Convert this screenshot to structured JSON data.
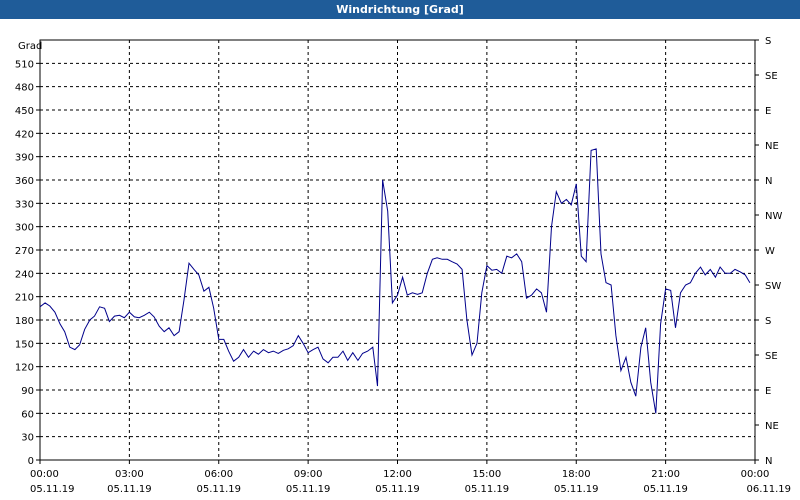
{
  "window": {
    "title": "Windrichtung [Grad]"
  },
  "chart_data": {
    "type": "line",
    "title": "Windrichtung [Grad]",
    "ylabel": "Grad",
    "xlabel": "",
    "ylim": [
      0,
      540
    ],
    "xlim_hours": [
      0,
      24
    ],
    "grid": true,
    "left_ticks": [
      0,
      30,
      60,
      90,
      120,
      150,
      180,
      210,
      240,
      270,
      300,
      330,
      360,
      390,
      420,
      450,
      480,
      510
    ],
    "right_ticks": [
      {
        "value": 0,
        "label": "N"
      },
      {
        "value": 45,
        "label": "NE"
      },
      {
        "value": 90,
        "label": "E"
      },
      {
        "value": 135,
        "label": "SE"
      },
      {
        "value": 180,
        "label": "S"
      },
      {
        "value": 225,
        "label": "SW"
      },
      {
        "value": 270,
        "label": "W"
      },
      {
        "value": 315,
        "label": "NW"
      },
      {
        "value": 360,
        "label": "N"
      },
      {
        "value": 405,
        "label": "NE"
      },
      {
        "value": 450,
        "label": "E"
      },
      {
        "value": 495,
        "label": "SE"
      },
      {
        "value": 540,
        "label": "S"
      }
    ],
    "x_ticks": [
      {
        "hour": 0,
        "time": "00:00",
        "date": "05.11.19"
      },
      {
        "hour": 3,
        "time": "03:00",
        "date": "05.11.19"
      },
      {
        "hour": 6,
        "time": "06:00",
        "date": "05.11.19"
      },
      {
        "hour": 9,
        "time": "09:00",
        "date": "05.11.19"
      },
      {
        "hour": 12,
        "time": "12:00",
        "date": "05.11.19"
      },
      {
        "hour": 15,
        "time": "15:00",
        "date": "05.11.19"
      },
      {
        "hour": 18,
        "time": "18:00",
        "date": "05.11.19"
      },
      {
        "hour": 21,
        "time": "21:00",
        "date": "05.11.19"
      },
      {
        "hour": 24,
        "time": "00:00",
        "date": "06.11.19"
      }
    ],
    "series": [
      {
        "color": "#00008b",
        "x_hours": [
          0,
          0.17,
          0.33,
          0.5,
          0.67,
          0.83,
          1.0,
          1.17,
          1.33,
          1.5,
          1.67,
          1.83,
          2.0,
          2.17,
          2.33,
          2.5,
          2.67,
          2.83,
          3.0,
          3.17,
          3.33,
          3.5,
          3.67,
          3.83,
          4.0,
          4.17,
          4.33,
          4.5,
          4.67,
          4.83,
          5.0,
          5.17,
          5.33,
          5.5,
          5.67,
          5.83,
          6.0,
          6.17,
          6.33,
          6.5,
          6.67,
          6.83,
          7.0,
          7.17,
          7.33,
          7.5,
          7.67,
          7.83,
          8.0,
          8.17,
          8.33,
          8.5,
          8.67,
          8.83,
          9.0,
          9.17,
          9.33,
          9.5,
          9.67,
          9.83,
          10.0,
          10.17,
          10.33,
          10.5,
          10.67,
          10.83,
          11.0,
          11.17,
          11.33,
          11.5,
          11.67,
          11.83,
          12.0,
          12.17,
          12.33,
          12.5,
          12.67,
          12.83,
          13.0,
          13.17,
          13.33,
          13.5,
          13.67,
          13.83,
          14.0,
          14.17,
          14.33,
          14.5,
          14.67,
          14.83,
          15.0,
          15.17,
          15.33,
          15.5,
          15.67,
          15.83,
          16.0,
          16.17,
          16.33,
          16.5,
          16.67,
          16.83,
          17.0,
          17.17,
          17.33,
          17.5,
          17.67,
          17.83,
          18.0,
          18.17,
          18.33,
          18.5,
          18.67,
          18.83,
          19.0,
          19.17,
          19.33,
          19.5,
          19.67,
          19.83,
          20.0,
          20.17,
          20.33,
          20.5,
          20.67,
          20.83,
          21.0,
          21.17,
          21.33,
          21.5,
          21.67,
          21.83,
          22.0,
          22.17,
          22.33,
          22.5,
          22.67,
          22.83,
          23.0,
          23.17,
          23.33,
          23.5,
          23.67,
          23.83
        ],
        "y": [
          197,
          202,
          198,
          190,
          175,
          165,
          145,
          142,
          148,
          168,
          180,
          185,
          197,
          195,
          178,
          185,
          186,
          183,
          190,
          184,
          183,
          186,
          190,
          184,
          172,
          165,
          170,
          160,
          165,
          205,
          253,
          245,
          238,
          217,
          222,
          195,
          155,
          155,
          140,
          127,
          132,
          142,
          132,
          140,
          136,
          142,
          138,
          140,
          137,
          141,
          143,
          147,
          160,
          150,
          138,
          142,
          145,
          130,
          125,
          132,
          132,
          140,
          128,
          138,
          128,
          137,
          140,
          145,
          95,
          360,
          320,
          202,
          212,
          235,
          212,
          215,
          213,
          215,
          240,
          258,
          260,
          258,
          258,
          255,
          252,
          245,
          180,
          135,
          150,
          215,
          250,
          244,
          245,
          240,
          262,
          260,
          265,
          255,
          208,
          212,
          220,
          215,
          190,
          300,
          345,
          330,
          335,
          328,
          355,
          262,
          255,
          398,
          400,
          265,
          228,
          225,
          160,
          115,
          132,
          100,
          82,
          145,
          170,
          100,
          60,
          175,
          220,
          218,
          170,
          215,
          225,
          228,
          240,
          248,
          238,
          245,
          235,
          248,
          240,
          240,
          245,
          242,
          238,
          228,
          225
        ]
      }
    ]
  }
}
